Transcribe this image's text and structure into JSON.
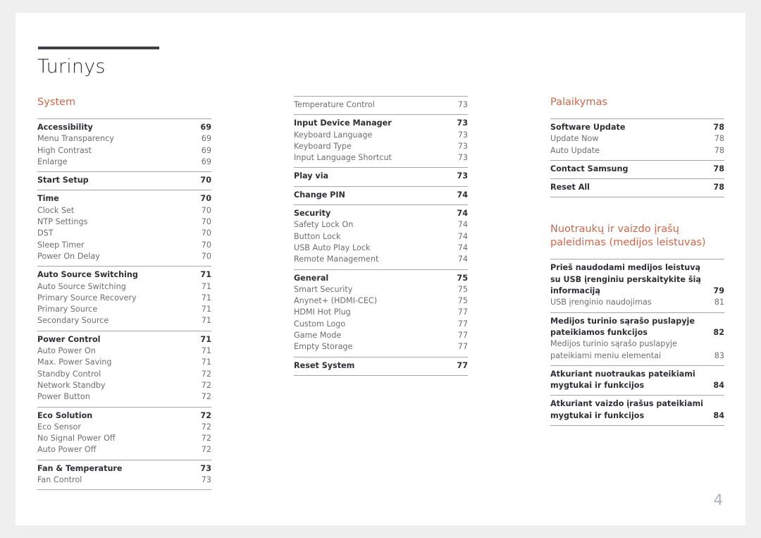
{
  "document": {
    "title": "Turinys",
    "page_number": "4",
    "accent_color": "#d4654a",
    "rule_color": "#3f3f4a"
  },
  "columns": [
    {
      "name": "column-1",
      "sections": [
        {
          "heading": "System",
          "groups": [
            {
              "entries": [
                {
                  "label": "Accessibility",
                  "page": "69",
                  "level": "head"
                },
                {
                  "label": "Menu Transparency",
                  "page": "69",
                  "level": "sub"
                },
                {
                  "label": "High Contrast",
                  "page": "69",
                  "level": "sub"
                },
                {
                  "label": "Enlarge",
                  "page": "69",
                  "level": "sub"
                }
              ]
            },
            {
              "entries": [
                {
                  "label": "Start Setup",
                  "page": "70",
                  "level": "head"
                }
              ]
            },
            {
              "entries": [
                {
                  "label": "Time",
                  "page": "70",
                  "level": "head"
                },
                {
                  "label": "Clock Set",
                  "page": "70",
                  "level": "sub"
                },
                {
                  "label": "NTP Settings",
                  "page": "70",
                  "level": "sub"
                },
                {
                  "label": "DST",
                  "page": "70",
                  "level": "sub"
                },
                {
                  "label": "Sleep Timer",
                  "page": "70",
                  "level": "sub"
                },
                {
                  "label": "Power On Delay",
                  "page": "70",
                  "level": "sub"
                }
              ]
            },
            {
              "entries": [
                {
                  "label": "Auto Source Switching",
                  "page": "71",
                  "level": "head"
                },
                {
                  "label": "Auto Source Switching",
                  "page": "71",
                  "level": "sub"
                },
                {
                  "label": "Primary Source Recovery",
                  "page": "71",
                  "level": "sub"
                },
                {
                  "label": "Primary Source",
                  "page": "71",
                  "level": "sub"
                },
                {
                  "label": "Secondary Source",
                  "page": "71",
                  "level": "sub"
                }
              ]
            },
            {
              "entries": [
                {
                  "label": "Power Control",
                  "page": "71",
                  "level": "head"
                },
                {
                  "label": "Auto Power On",
                  "page": "71",
                  "level": "sub"
                },
                {
                  "label": "Max. Power Saving",
                  "page": "71",
                  "level": "sub"
                },
                {
                  "label": "Standby Control",
                  "page": "72",
                  "level": "sub"
                },
                {
                  "label": "Network Standby",
                  "page": "72",
                  "level": "sub"
                },
                {
                  "label": "Power Button",
                  "page": "72",
                  "level": "sub"
                }
              ]
            },
            {
              "entries": [
                {
                  "label": "Eco Solution",
                  "page": "72",
                  "level": "head"
                },
                {
                  "label": "Eco Sensor",
                  "page": "72",
                  "level": "sub"
                },
                {
                  "label": "No Signal Power Off",
                  "page": "72",
                  "level": "sub"
                },
                {
                  "label": "Auto Power Off",
                  "page": "72",
                  "level": "sub"
                }
              ]
            },
            {
              "entries": [
                {
                  "label": "Fan & Temperature",
                  "page": "73",
                  "level": "head"
                },
                {
                  "label": "Fan Control",
                  "page": "73",
                  "level": "sub"
                }
              ]
            }
          ]
        }
      ]
    },
    {
      "name": "column-2",
      "sections": [
        {
          "heading": "",
          "groups": [
            {
              "entries": [
                {
                  "label": "Temperature Control",
                  "page": "73",
                  "level": "sub"
                }
              ]
            },
            {
              "entries": [
                {
                  "label": "Input Device Manager",
                  "page": "73",
                  "level": "head"
                },
                {
                  "label": "Keyboard Language",
                  "page": "73",
                  "level": "sub"
                },
                {
                  "label": "Keyboard Type",
                  "page": "73",
                  "level": "sub"
                },
                {
                  "label": "Input Language Shortcut",
                  "page": "73",
                  "level": "sub"
                }
              ]
            },
            {
              "entries": [
                {
                  "label": "Play via",
                  "page": "73",
                  "level": "head"
                }
              ]
            },
            {
              "entries": [
                {
                  "label": "Change PIN",
                  "page": "74",
                  "level": "head"
                }
              ]
            },
            {
              "entries": [
                {
                  "label": "Security",
                  "page": "74",
                  "level": "head"
                },
                {
                  "label": "Safety Lock On",
                  "page": "74",
                  "level": "sub"
                },
                {
                  "label": "Button Lock",
                  "page": "74",
                  "level": "sub"
                },
                {
                  "label": "USB Auto Play Lock",
                  "page": "74",
                  "level": "sub"
                },
                {
                  "label": "Remote Management",
                  "page": "74",
                  "level": "sub"
                }
              ]
            },
            {
              "entries": [
                {
                  "label": "General",
                  "page": "75",
                  "level": "head"
                },
                {
                  "label": "Smart Security",
                  "page": "75",
                  "level": "sub"
                },
                {
                  "label": "Anynet+ (HDMI-CEC)",
                  "page": "75",
                  "level": "sub"
                },
                {
                  "label": "HDMI Hot Plug",
                  "page": "77",
                  "level": "sub"
                },
                {
                  "label": "Custom Logo",
                  "page": "77",
                  "level": "sub"
                },
                {
                  "label": "Game Mode",
                  "page": "77",
                  "level": "sub"
                },
                {
                  "label": "Empty Storage",
                  "page": "77",
                  "level": "sub"
                }
              ]
            },
            {
              "entries": [
                {
                  "label": "Reset System",
                  "page": "77",
                  "level": "head"
                }
              ]
            }
          ]
        }
      ]
    },
    {
      "name": "column-3",
      "sections": [
        {
          "heading": "Palaikymas",
          "groups": [
            {
              "entries": [
                {
                  "label": "Software Update",
                  "page": "78",
                  "level": "head"
                },
                {
                  "label": "Update Now",
                  "page": "78",
                  "level": "sub"
                },
                {
                  "label": "Auto Update",
                  "page": "78",
                  "level": "sub"
                }
              ]
            },
            {
              "entries": [
                {
                  "label": "Contact Samsung",
                  "page": "78",
                  "level": "head"
                }
              ]
            },
            {
              "entries": [
                {
                  "label": "Reset All",
                  "page": "78",
                  "level": "head"
                }
              ]
            }
          ]
        },
        {
          "heading": "Nuotraukų ir vaizdo įrašų paleidimas (medijos leistuvas)",
          "groups": [
            {
              "entries": [
                {
                  "label": "Prieš naudodami medijos leistuvą su USB įrenginiu perskaitykite šią informaciją",
                  "page": "79",
                  "level": "head"
                },
                {
                  "label": "USB įrenginio naudojimas",
                  "page": "81",
                  "level": "sub"
                }
              ]
            },
            {
              "entries": [
                {
                  "label": "Medijos turinio sąrašo puslapyje pateikiamos funkcijos",
                  "page": "82",
                  "level": "head"
                },
                {
                  "label": "Medijos turinio sąrašo puslapyje pateikiami meniu elementai",
                  "page": "83",
                  "level": "sub"
                }
              ]
            },
            {
              "entries": [
                {
                  "label": "Atkuriant nuotraukas pateikiami mygtukai ir funkcijos",
                  "page": "84",
                  "level": "head"
                }
              ]
            },
            {
              "entries": [
                {
                  "label": "Atkuriant vaizdo įrašus pateikiami mygtukai ir funkcijos",
                  "page": "84",
                  "level": "head"
                }
              ]
            }
          ]
        }
      ]
    }
  ]
}
